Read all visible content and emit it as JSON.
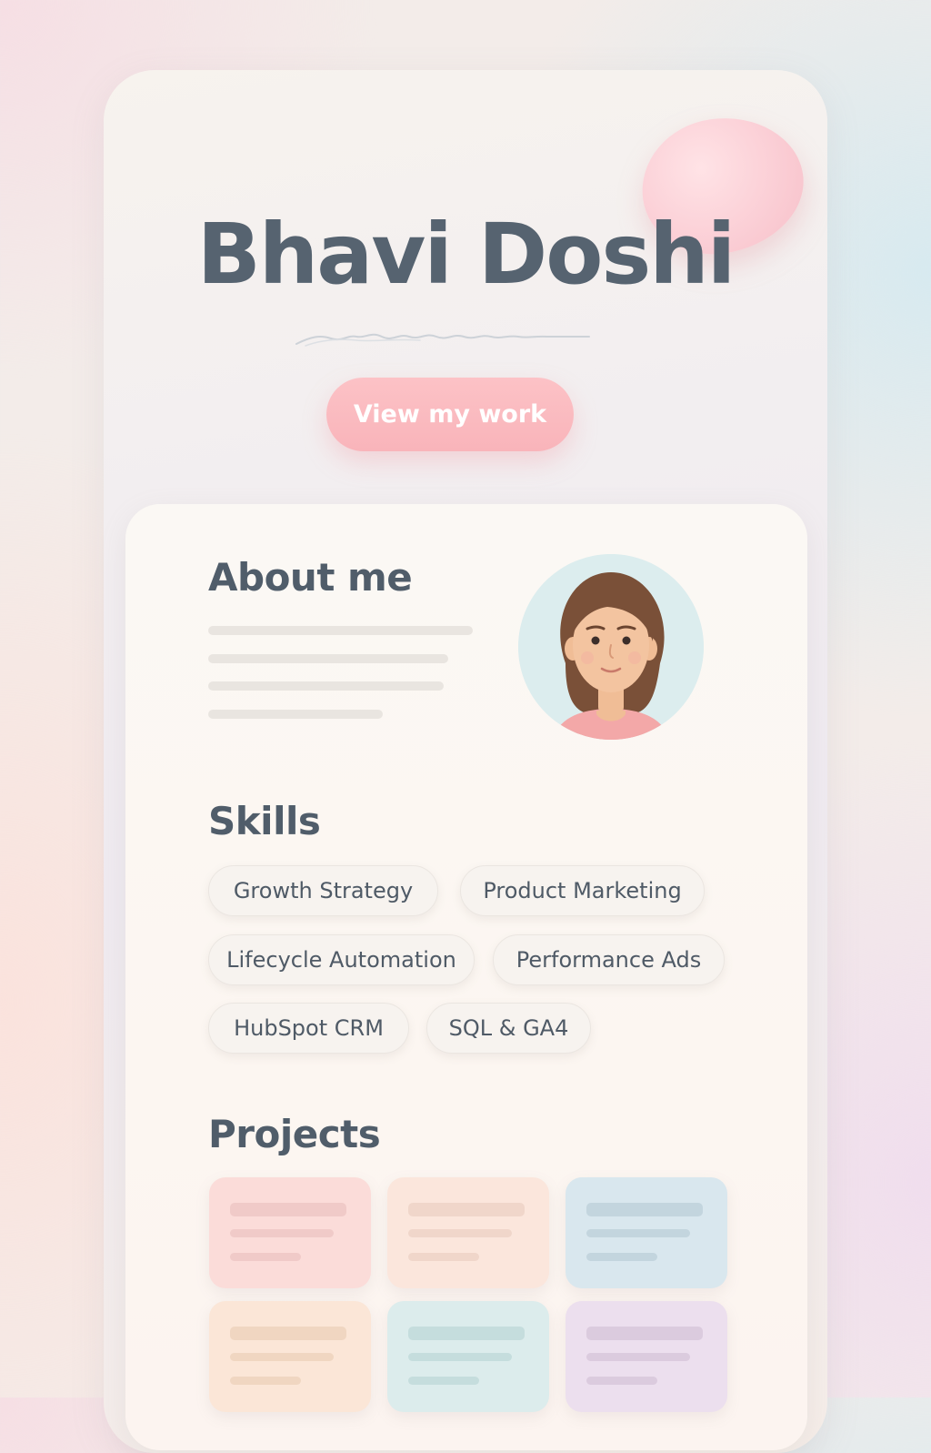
{
  "hero": {
    "name": "Bhavi Doshi",
    "cta_label": "View my work"
  },
  "about": {
    "heading": "About me"
  },
  "skills": {
    "heading": "Skills",
    "items": [
      "Growth Strategy",
      "Product Marketing",
      "Lifecycle Automation",
      "Performance Ads",
      "HubSpot CRM",
      "SQL & GA4"
    ]
  },
  "projects": {
    "heading": "Projects",
    "card_colors": [
      "#fbdcd9",
      "#fbe6dc",
      "#d9e7ee",
      "#fbe6d7",
      "#dcecec",
      "#ecdfee"
    ]
  },
  "colors": {
    "accent": "#f9b4ba",
    "text": "#566370"
  }
}
